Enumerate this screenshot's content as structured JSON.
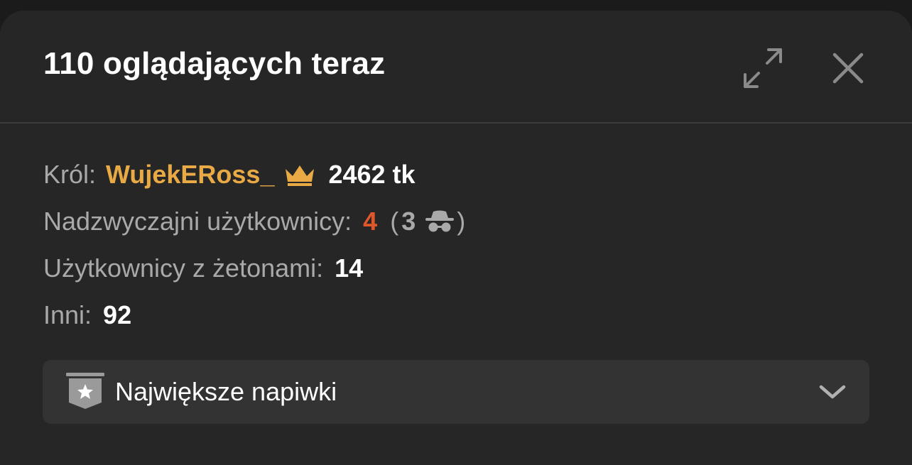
{
  "header": {
    "title": "110 oglądających teraz",
    "expand_icon": "expand-arrows-icon",
    "close_icon": "close-x-icon"
  },
  "stats": {
    "king": {
      "label": "Król:",
      "username": "WujekERoss_",
      "icon": "crown-icon",
      "tokens": "2462 tk"
    },
    "extraordinary": {
      "label": "Nadzwyczajni użytkownicy:",
      "count": "4",
      "anonymous_open": "(",
      "anonymous_count": "3",
      "anonymous_icon": "spy-incognito-icon",
      "anonymous_close": ")"
    },
    "with_tokens": {
      "label": "Użytkownicy z żetonami:",
      "count": "14"
    },
    "others": {
      "label": "Inni:",
      "count": "92"
    }
  },
  "dropdown": {
    "label": "Największe napiwki",
    "icon": "star-badge-icon",
    "chevron_icon": "chevron-down-icon"
  },
  "colors": {
    "panel_bg": "#262626",
    "king_name": "#e9aa45",
    "extraordinary_count": "#e0582a",
    "muted_label": "#a9a9a9"
  }
}
